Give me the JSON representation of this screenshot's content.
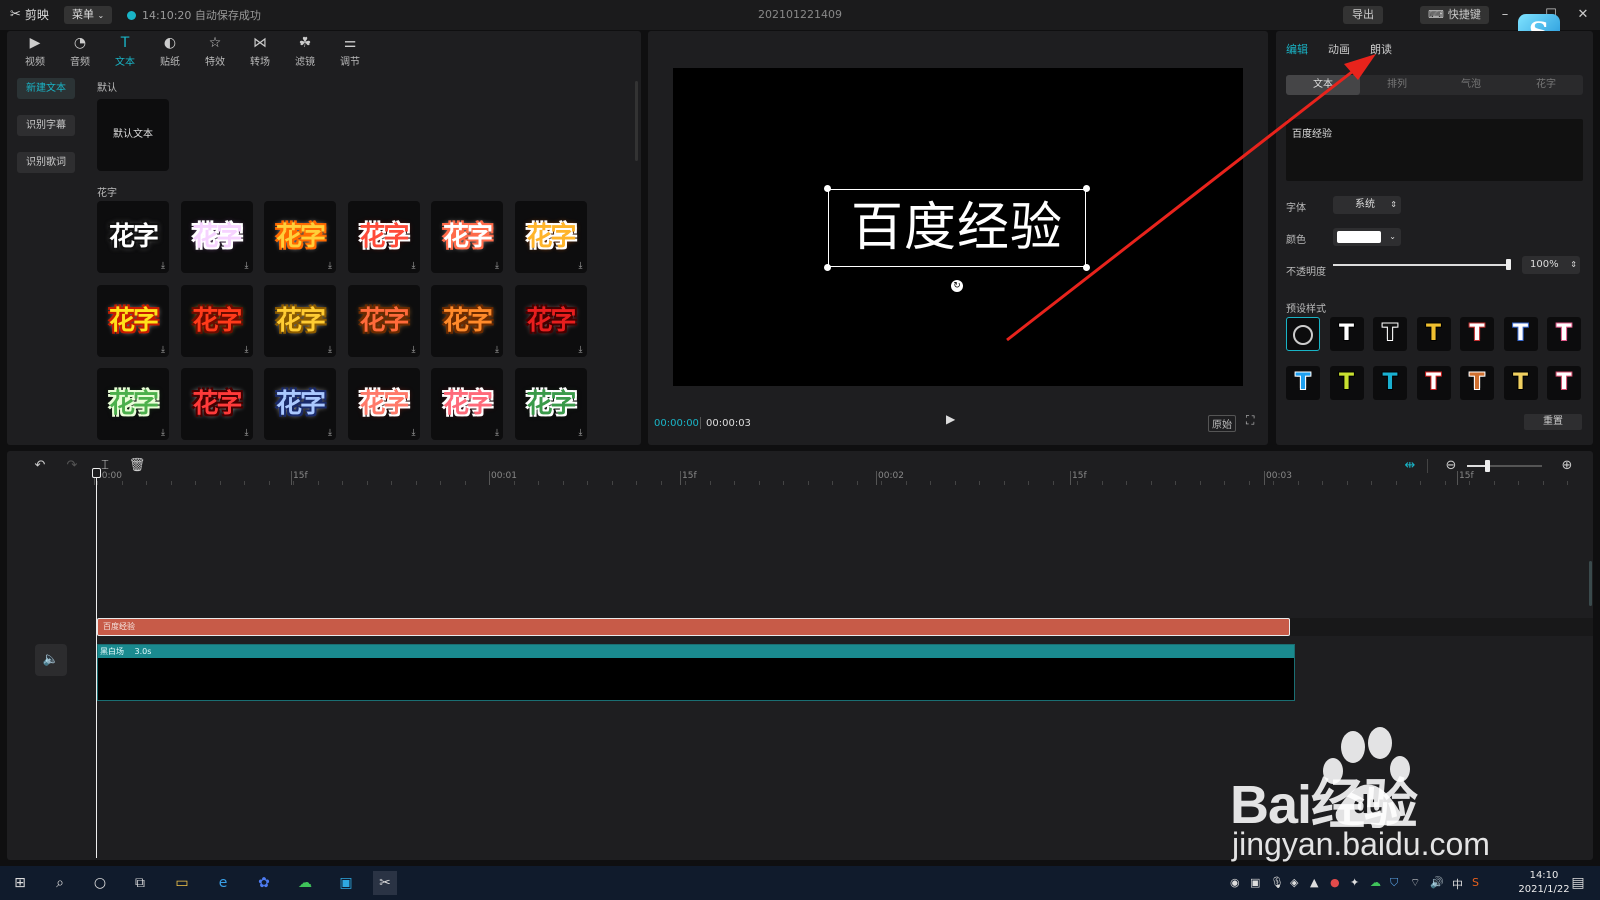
{
  "titlebar": {
    "app_name": "剪映",
    "menu_label": "菜单",
    "autosave_status": "14:10:20 自动保存成功",
    "project_name": "202101221409",
    "export_label": "导出",
    "shortcut_label": "快捷键"
  },
  "tool_tabs": [
    {
      "label": "视频",
      "icon": "video-icon"
    },
    {
      "label": "音频",
      "icon": "audio-icon"
    },
    {
      "label": "文本",
      "icon": "text-icon"
    },
    {
      "label": "贴纸",
      "icon": "sticker-icon"
    },
    {
      "label": "特效",
      "icon": "effects-icon"
    },
    {
      "label": "转场",
      "icon": "transition-icon"
    },
    {
      "label": "滤镜",
      "icon": "filter-icon"
    },
    {
      "label": "调节",
      "icon": "adjust-icon"
    }
  ],
  "media_sidebar": {
    "new_text": "新建文本",
    "recognize_subtitle": "识别字幕",
    "recognize_lyrics": "识别歌词"
  },
  "media_library": {
    "default_section": "默认",
    "default_text_card": "默认文本",
    "fancy_section": "花字",
    "fancy_label": "花字"
  },
  "preview": {
    "overlay_text": "百度经验",
    "current_time": "00:00:00",
    "total_time": "00:00:03",
    "ratio_label": "原始"
  },
  "props": {
    "tabs": [
      "编辑",
      "动画",
      "朗读"
    ],
    "segments": [
      "文本",
      "排列",
      "气泡",
      "花字"
    ],
    "text_value": "百度经验",
    "font_label": "字体",
    "font_value": "系统",
    "color_label": "颜色",
    "color_value": "#ffffff",
    "opacity_label": "不透明度",
    "opacity_value": "100%",
    "opacity_fraction": 1.0,
    "preset_label": "预设样式",
    "reset_label": "重置"
  },
  "timeline": {
    "ruler_labels": [
      "00:00",
      "15f",
      "00:01",
      "15f",
      "00:02",
      "15f",
      "00:03",
      "15f"
    ],
    "text_clip_label": "百度经验",
    "video_clip_label": "黑白场",
    "video_clip_duration": "3.0s"
  },
  "taskbar": {
    "ime_label": "中",
    "clock_time": "14:10",
    "clock_date": "2021/1/22"
  },
  "watermark": {
    "brand_text": "Bai经验",
    "url": "jingyan.baidu.com",
    "du_text": "du"
  },
  "colors": {
    "accent": "#19b4c6",
    "text_clip": "#c75b48",
    "video_clip_header": "#1a8a8f",
    "annotation_arrow": "#e8231c"
  }
}
